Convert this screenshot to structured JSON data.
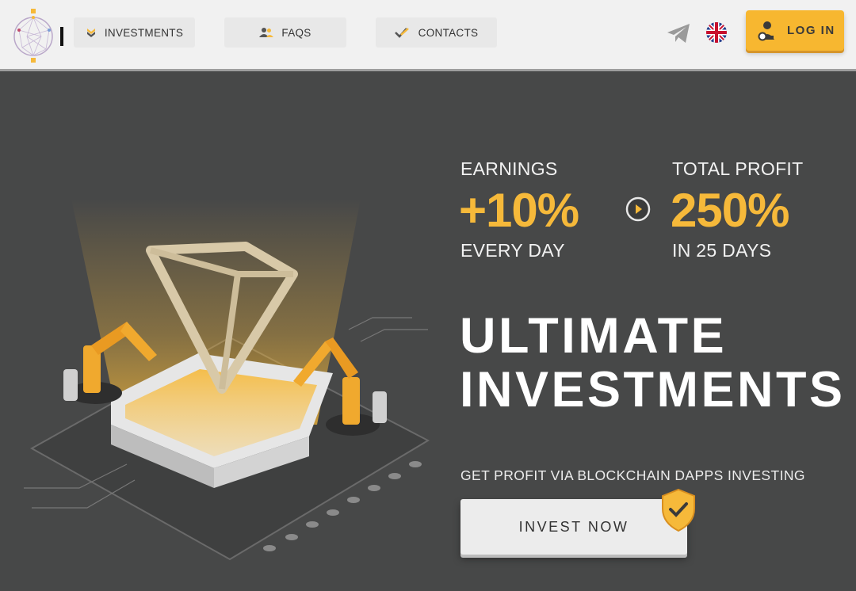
{
  "header": {
    "nav": [
      {
        "label": "INVESTMENTS",
        "icon": "chevrons-down-icon"
      },
      {
        "label": "FAQS",
        "icon": "users-icon"
      },
      {
        "label": "CONTACTS",
        "icon": "checkmark-icon"
      }
    ],
    "login_label": "LOG IN"
  },
  "hero": {
    "earnings": {
      "label": "EARNINGS",
      "value": "+10%",
      "sub": "EVERY DAY"
    },
    "total_profit": {
      "label": "TOTAL PROFIT",
      "value": "250%",
      "sub": "IN 25 DAYS"
    },
    "title_line1": "ULTIMATE",
    "title_line2": "INVESTMENTS",
    "subtitle": "GET PROFIT VIA BLOCKCHAIN DAPPS INVESTING",
    "cta_label": "INVEST NOW"
  },
  "colors": {
    "accent": "#f6b93a",
    "background": "#474848",
    "header": "#f1f1f1"
  }
}
